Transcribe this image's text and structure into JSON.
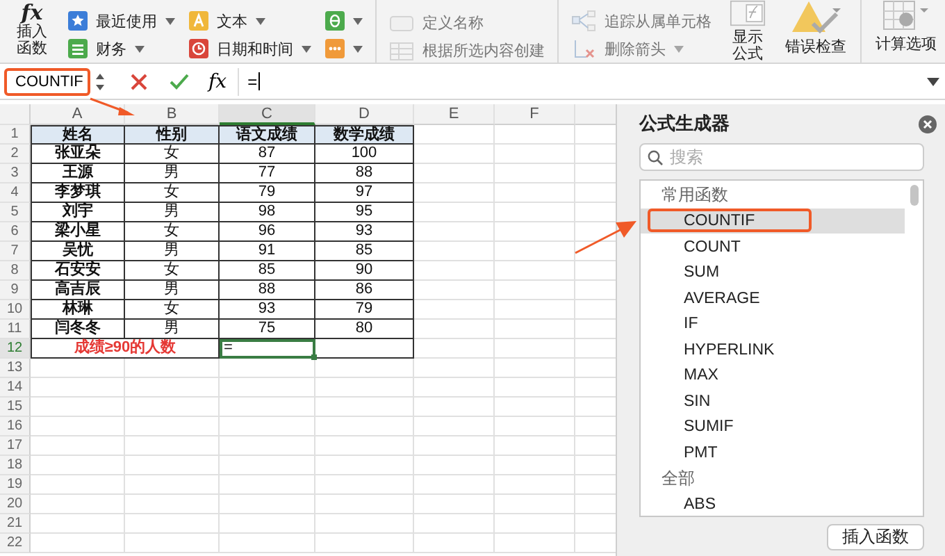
{
  "ribbon": {
    "insert_function": {
      "symbol": "fx",
      "label": "插入函数"
    },
    "columns": [
      [
        {
          "kind": "star",
          "label": "最近使用",
          "dropdown": true,
          "disabled": false
        },
        {
          "kind": "book",
          "label": "财务",
          "dropdown": true,
          "disabled": false
        }
      ],
      [
        {
          "kind": "text",
          "label": "文本",
          "dropdown": true,
          "disabled": false
        },
        {
          "kind": "clock",
          "label": "日期和时间",
          "dropdown": true,
          "disabled": false
        }
      ],
      [
        {
          "kind": "theta",
          "dropdown": true,
          "disabled": false
        },
        {
          "kind": "dots",
          "dropdown": true,
          "disabled": false
        }
      ],
      [
        {
          "kind": "tag",
          "label": "定义名称",
          "dropdown": false,
          "disabled": true
        },
        {
          "kind": "table",
          "label": "根据所选内容创建",
          "dropdown": false,
          "disabled": true
        }
      ],
      [
        {
          "kind": "trace",
          "label": "追踪从属单元格",
          "dropdown": false,
          "disabled": true
        },
        {
          "kind": "remove",
          "label": "删除箭头",
          "dropdown": true,
          "disabled": true
        }
      ]
    ],
    "big_buttons": [
      {
        "kind": "show",
        "label": "显示公式"
      },
      {
        "kind": "check",
        "label": "错误检查"
      },
      {
        "kind": "calc",
        "label": "计算选项"
      }
    ]
  },
  "formula_bar": {
    "name_box": "COUNTIF",
    "highlighted": true,
    "function_symbol": "fx",
    "formula": "="
  },
  "sheet": {
    "columns": [
      {
        "label": "A",
        "selected": false
      },
      {
        "label": "B",
        "selected": false
      },
      {
        "label": "C",
        "selected": true
      },
      {
        "label": "D",
        "selected": false
      },
      {
        "label": "E",
        "selected": false
      },
      {
        "label": "F",
        "selected": false
      }
    ],
    "rows": [
      {
        "number": "1",
        "selected": false,
        "cells": [
          {
            "kind": "header",
            "text": "姓名"
          },
          {
            "kind": "header",
            "text": "性别"
          },
          {
            "kind": "header",
            "text": "语文成绩"
          },
          {
            "kind": "header",
            "text": "数学成绩"
          }
        ]
      },
      {
        "number": "2",
        "selected": false,
        "cells": [
          {
            "kind": "name",
            "text": "张亚朵"
          },
          {
            "kind": "data",
            "text": "女"
          },
          {
            "kind": "data",
            "text": "87"
          },
          {
            "kind": "data",
            "text": "100"
          }
        ]
      },
      {
        "number": "3",
        "selected": false,
        "cells": [
          {
            "kind": "name",
            "text": "王源"
          },
          {
            "kind": "data",
            "text": "男"
          },
          {
            "kind": "data",
            "text": "77"
          },
          {
            "kind": "data",
            "text": "88"
          }
        ]
      },
      {
        "number": "4",
        "selected": false,
        "cells": [
          {
            "kind": "name",
            "text": "李梦琪"
          },
          {
            "kind": "data",
            "text": "女"
          },
          {
            "kind": "data",
            "text": "79"
          },
          {
            "kind": "data",
            "text": "97"
          }
        ]
      },
      {
        "number": "5",
        "selected": false,
        "cells": [
          {
            "kind": "name",
            "text": "刘宇"
          },
          {
            "kind": "data",
            "text": "男"
          },
          {
            "kind": "data",
            "text": "98"
          },
          {
            "kind": "data",
            "text": "95"
          }
        ]
      },
      {
        "number": "6",
        "selected": false,
        "cells": [
          {
            "kind": "name",
            "text": "梁小星"
          },
          {
            "kind": "data",
            "text": "女"
          },
          {
            "kind": "data",
            "text": "96"
          },
          {
            "kind": "data",
            "text": "93"
          }
        ]
      },
      {
        "number": "7",
        "selected": false,
        "cells": [
          {
            "kind": "name",
            "text": "吴忧"
          },
          {
            "kind": "data",
            "text": "男"
          },
          {
            "kind": "data",
            "text": "91"
          },
          {
            "kind": "data",
            "text": "85"
          }
        ]
      },
      {
        "number": "8",
        "selected": false,
        "cells": [
          {
            "kind": "name",
            "text": "石安安"
          },
          {
            "kind": "data",
            "text": "女"
          },
          {
            "kind": "data",
            "text": "85"
          },
          {
            "kind": "data",
            "text": "90"
          }
        ]
      },
      {
        "number": "9",
        "selected": false,
        "cells": [
          {
            "kind": "name",
            "text": "高吉辰"
          },
          {
            "kind": "data",
            "text": "男"
          },
          {
            "kind": "data",
            "text": "88"
          },
          {
            "kind": "data",
            "text": "86"
          }
        ]
      },
      {
        "number": "10",
        "selected": false,
        "cells": [
          {
            "kind": "name",
            "text": "林琳"
          },
          {
            "kind": "data",
            "text": "女"
          },
          {
            "kind": "data",
            "text": "93"
          },
          {
            "kind": "data",
            "text": "79"
          }
        ]
      },
      {
        "number": "11",
        "selected": false,
        "cells": [
          {
            "kind": "name",
            "text": "闫冬冬"
          },
          {
            "kind": "data",
            "text": "男"
          },
          {
            "kind": "data",
            "text": "75"
          },
          {
            "kind": "data",
            "text": "80"
          }
        ]
      },
      {
        "number": "12",
        "selected": true,
        "cells": [
          {
            "kind": "label",
            "text": "成绩≥90的人数"
          },
          {
            "kind": "active",
            "text": "="
          },
          {
            "kind": "data",
            "text": ""
          }
        ]
      },
      {
        "number": "13",
        "selected": false,
        "cells": []
      },
      {
        "number": "14",
        "selected": false,
        "cells": []
      },
      {
        "number": "15",
        "selected": false,
        "cells": []
      },
      {
        "number": "16",
        "selected": false,
        "cells": []
      },
      {
        "number": "17",
        "selected": false,
        "cells": []
      },
      {
        "number": "18",
        "selected": false,
        "cells": []
      },
      {
        "number": "19",
        "selected": false,
        "cells": []
      },
      {
        "number": "20",
        "selected": false,
        "cells": []
      },
      {
        "number": "21",
        "selected": false,
        "cells": []
      },
      {
        "number": "22",
        "selected": false,
        "cells": []
      }
    ]
  },
  "builder": {
    "title": "公式生成器",
    "search": {
      "placeholder": "搜索"
    },
    "groups": [
      {
        "label": "常用函数",
        "items": [
          {
            "label": "COUNTIF",
            "selected": true,
            "highlighted": true
          },
          {
            "label": "COUNT",
            "selected": false,
            "highlighted": false
          },
          {
            "label": "SUM",
            "selected": false,
            "highlighted": false
          },
          {
            "label": "AVERAGE",
            "selected": false,
            "highlighted": false
          },
          {
            "label": "IF",
            "selected": false,
            "highlighted": false
          },
          {
            "label": "HYPERLINK",
            "selected": false,
            "highlighted": false
          },
          {
            "label": "MAX",
            "selected": false,
            "highlighted": false
          },
          {
            "label": "SIN",
            "selected": false,
            "highlighted": false
          },
          {
            "label": "SUMIF",
            "selected": false,
            "highlighted": false
          },
          {
            "label": "PMT",
            "selected": false,
            "highlighted": false
          }
        ]
      },
      {
        "label": "全部",
        "items": [
          {
            "label": "ABS",
            "selected": false,
            "highlighted": false
          }
        ]
      }
    ],
    "button": "插入函数"
  }
}
